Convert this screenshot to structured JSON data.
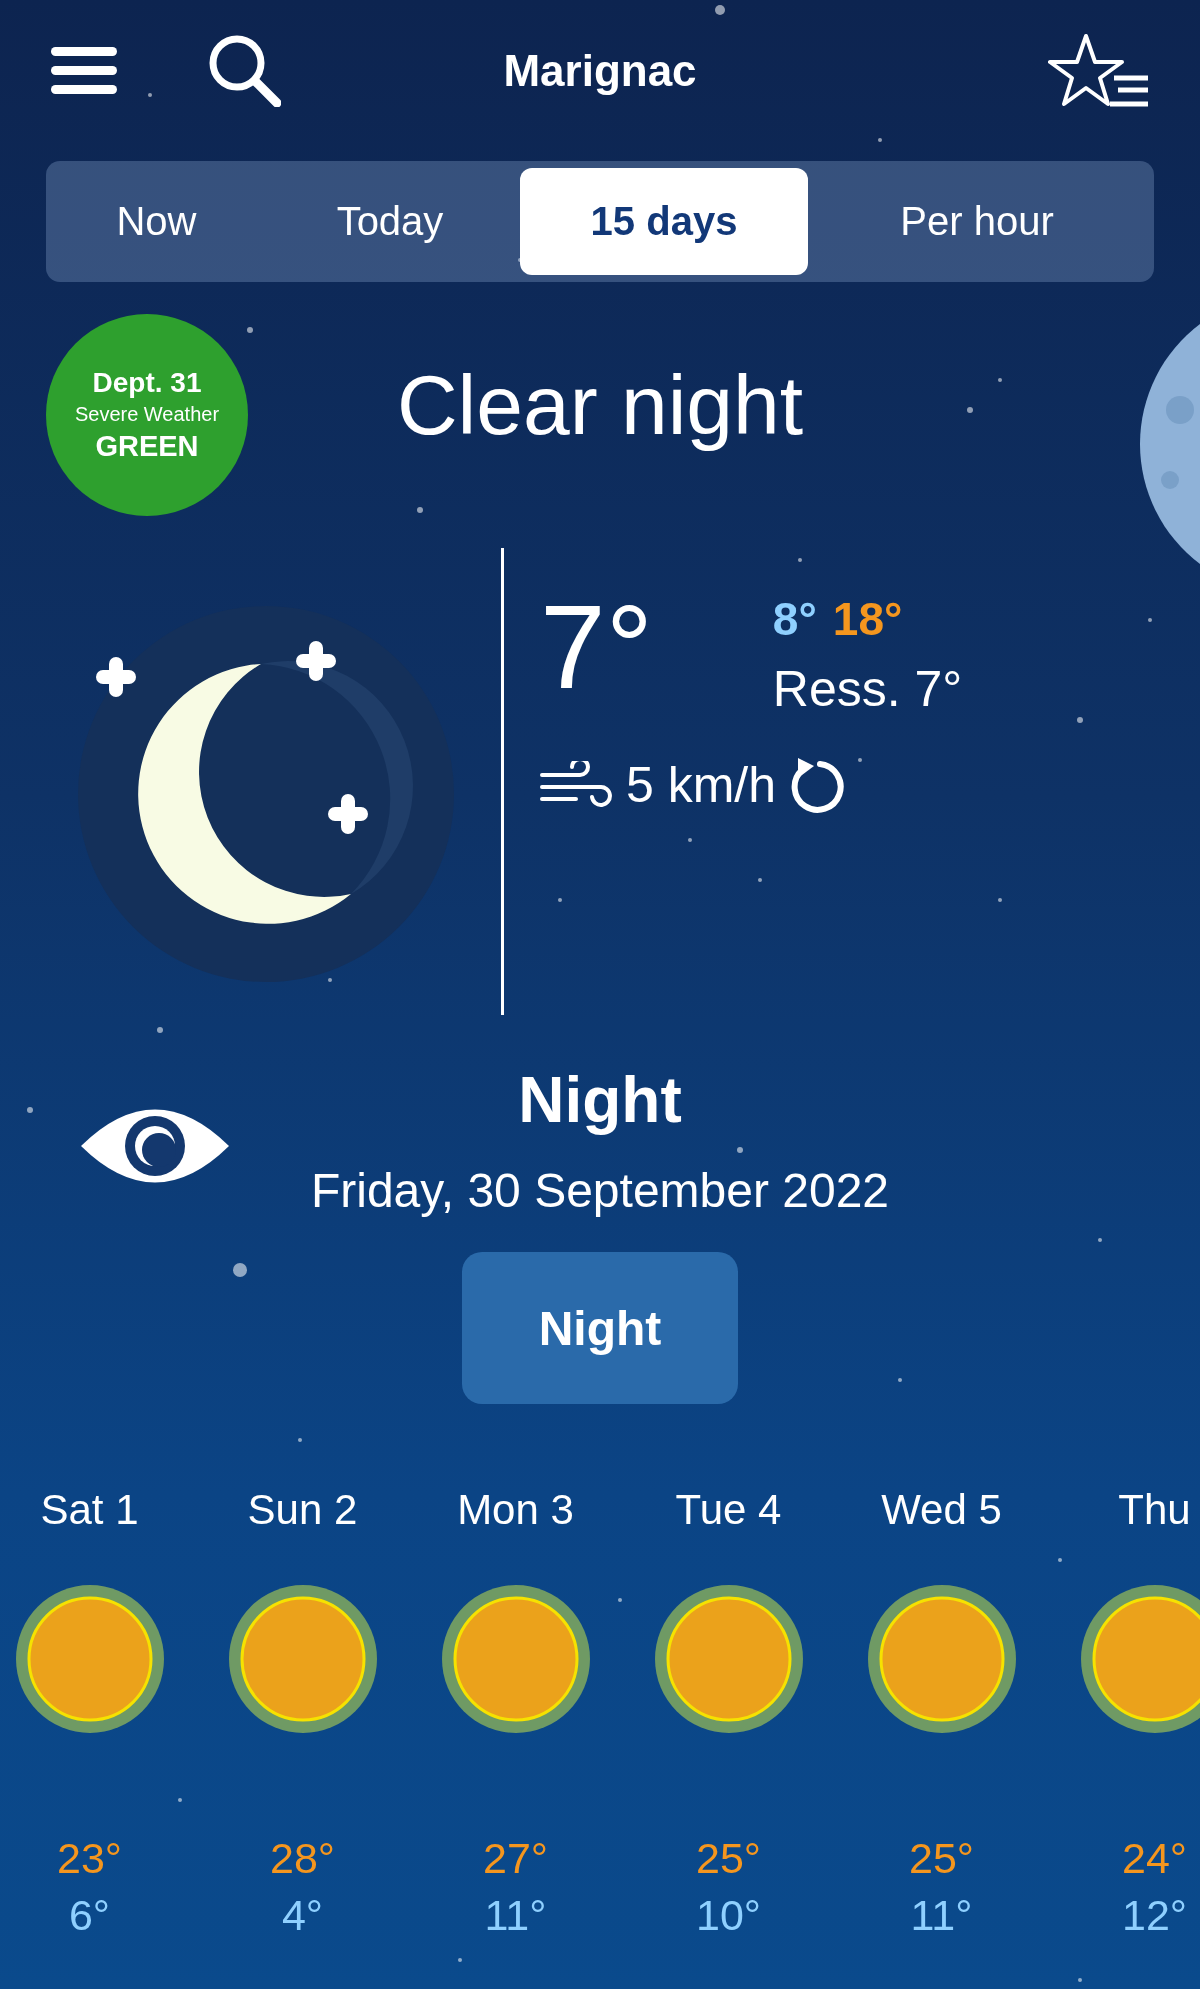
{
  "header": {
    "title": "Marignac"
  },
  "tabs": [
    {
      "label": "Now",
      "selected": false
    },
    {
      "label": "Today",
      "selected": false
    },
    {
      "label": "15 days",
      "selected": true
    },
    {
      "label": "Per hour",
      "selected": false
    }
  ],
  "alert": {
    "department": "Dept. 31",
    "caption": "Severe Weather",
    "level": "GREEN",
    "color": "#2ea02e"
  },
  "current": {
    "condition": "Clear night",
    "temperature": "7°",
    "min": "8°",
    "max": "18°",
    "feels_like": "Ress. 7°",
    "wind": "5 km/h"
  },
  "period": {
    "title": "Night",
    "date": "Friday, 30 September 2022",
    "button": "Night"
  },
  "forecast": [
    {
      "day": "Sat 1",
      "kind": "sun",
      "high": "23°",
      "low": "6°"
    },
    {
      "day": "Sun 2",
      "kind": "sun",
      "high": "28°",
      "low": "4°"
    },
    {
      "day": "Mon 3",
      "kind": "sun",
      "high": "27°",
      "low": "11°"
    },
    {
      "day": "Tue 4",
      "kind": "sun",
      "high": "25°",
      "low": "10°"
    },
    {
      "day": "Wed 5",
      "kind": "sun",
      "high": "25°",
      "low": "11°"
    },
    {
      "day": "Thu",
      "kind": "sun",
      "high": "24°",
      "low": "12°"
    }
  ]
}
